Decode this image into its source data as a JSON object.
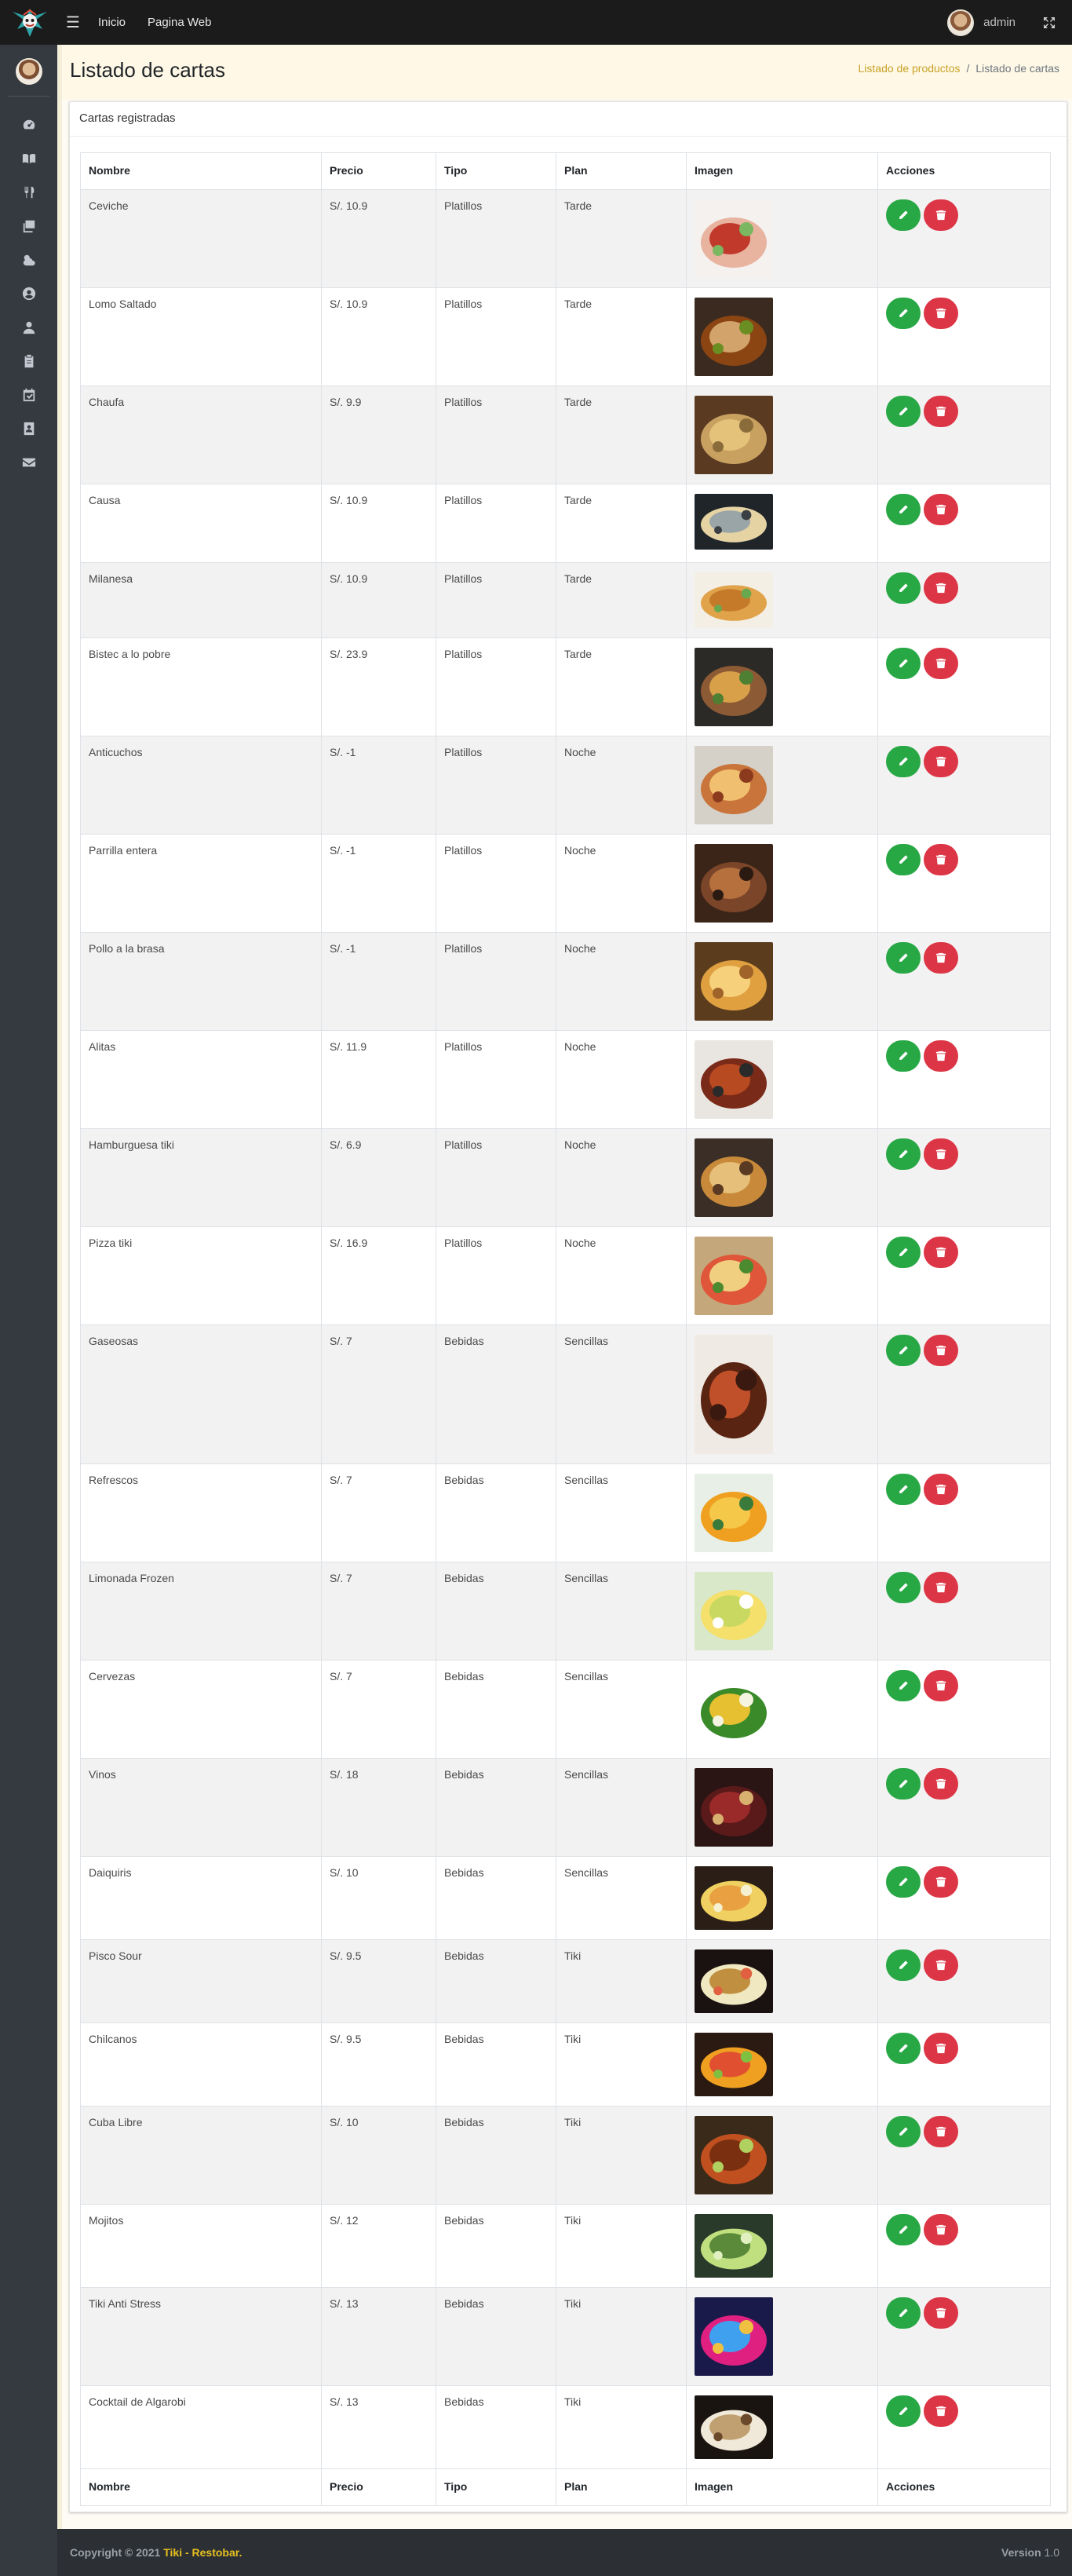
{
  "navbar": {
    "links": [
      "Inicio",
      "Pagina Web"
    ],
    "user": "admin"
  },
  "sidebar": {
    "icons": [
      "dashboard-icon",
      "menu-book-icon",
      "utensils-icon",
      "layers-icon",
      "weather-icon",
      "user-circle-icon",
      "user-icon",
      "clipboard-icon",
      "calendar-check-icon",
      "contact-icon",
      "envelope-icon"
    ]
  },
  "header": {
    "title": "Listado de cartas",
    "breadcrumb_link": "Listado de productos",
    "breadcrumb_sep": "/",
    "breadcrumb_active": "Listado de cartas"
  },
  "card": {
    "title": "Cartas registradas"
  },
  "table": {
    "columns": [
      "Nombre",
      "Precio",
      "Tipo",
      "Plan",
      "Imagen",
      "Acciones"
    ],
    "rows": [
      {
        "nombre": "Ceviche",
        "precio": "S/. 10.9",
        "tipo": "Platillos",
        "plan": "Tarde"
      },
      {
        "nombre": "Lomo Saltado",
        "precio": "S/. 10.9",
        "tipo": "Platillos",
        "plan": "Tarde"
      },
      {
        "nombre": "Chaufa",
        "precio": "S/. 9.9",
        "tipo": "Platillos",
        "plan": "Tarde"
      },
      {
        "nombre": "Causa",
        "precio": "S/. 10.9",
        "tipo": "Platillos",
        "plan": "Tarde"
      },
      {
        "nombre": "Milanesa",
        "precio": "S/. 10.9",
        "tipo": "Platillos",
        "plan": "Tarde"
      },
      {
        "nombre": "Bistec a lo pobre",
        "precio": "S/. 23.9",
        "tipo": "Platillos",
        "plan": "Tarde"
      },
      {
        "nombre": "Anticuchos",
        "precio": "S/. -1",
        "tipo": "Platillos",
        "plan": "Noche"
      },
      {
        "nombre": "Parrilla entera",
        "precio": "S/. -1",
        "tipo": "Platillos",
        "plan": "Noche"
      },
      {
        "nombre": "Pollo a la brasa",
        "precio": "S/. -1",
        "tipo": "Platillos",
        "plan": "Noche"
      },
      {
        "nombre": "Alitas",
        "precio": "S/. 11.9",
        "tipo": "Platillos",
        "plan": "Noche"
      },
      {
        "nombre": "Hamburguesa tiki",
        "precio": "S/. 6.9",
        "tipo": "Platillos",
        "plan": "Noche"
      },
      {
        "nombre": "Pizza tiki",
        "precio": "S/. 16.9",
        "tipo": "Platillos",
        "plan": "Noche"
      },
      {
        "nombre": "Gaseosas",
        "precio": "S/. 7",
        "tipo": "Bebidas",
        "plan": "Sencillas"
      },
      {
        "nombre": "Refrescos",
        "precio": "S/. 7",
        "tipo": "Bebidas",
        "plan": "Sencillas"
      },
      {
        "nombre": "Limonada Frozen",
        "precio": "S/. 7",
        "tipo": "Bebidas",
        "plan": "Sencillas"
      },
      {
        "nombre": "Cervezas",
        "precio": "S/. 7",
        "tipo": "Bebidas",
        "plan": "Sencillas"
      },
      {
        "nombre": "Vinos",
        "precio": "S/. 18",
        "tipo": "Bebidas",
        "plan": "Sencillas"
      },
      {
        "nombre": "Daiquiris",
        "precio": "S/. 10",
        "tipo": "Bebidas",
        "plan": "Sencillas"
      },
      {
        "nombre": "Pisco Sour",
        "precio": "S/. 9.5",
        "tipo": "Bebidas",
        "plan": "Tiki"
      },
      {
        "nombre": "Chilcanos",
        "precio": "S/. 9.5",
        "tipo": "Bebidas",
        "plan": "Tiki"
      },
      {
        "nombre": "Cuba Libre",
        "precio": "S/. 10",
        "tipo": "Bebidas",
        "plan": "Tiki"
      },
      {
        "nombre": "Mojitos",
        "precio": "S/. 12",
        "tipo": "Bebidas",
        "plan": "Tiki"
      },
      {
        "nombre": "Tiki Anti Stress",
        "precio": "S/. 13",
        "tipo": "Bebidas",
        "plan": "Tiki"
      },
      {
        "nombre": "Cocktail de Algarobi",
        "precio": "S/. 13",
        "tipo": "Bebidas",
        "plan": "Tiki"
      }
    ]
  },
  "footer": {
    "copyright": "Copyright © 2021",
    "brand": "Tiki - Restobar.",
    "version_label": "Version",
    "version": "1.0"
  },
  "colors": {
    "accent": "#c9a227",
    "edit": "#28a745",
    "delete": "#dc3545",
    "brand": "#e8c020"
  }
}
